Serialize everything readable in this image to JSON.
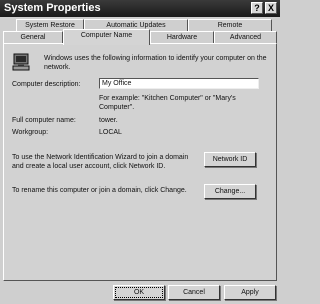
{
  "window": {
    "title": "System Properties"
  },
  "titlebar_buttons": {
    "help": "?",
    "close": "X"
  },
  "tabs_back": [
    "System Restore",
    "Automatic Updates",
    "Remote"
  ],
  "tabs_front": [
    "General",
    "Computer Name",
    "Hardware",
    "Advanced"
  ],
  "active_tab": "Computer Name",
  "computer_name": {
    "intro": "Windows uses the following information to identify your computer on the network.",
    "description_label": "Computer description:",
    "description_value": "My Office",
    "example": "For example: \"Kitchen Computer\" or \"Mary's Computer\".",
    "full_name_label": "Full computer name:",
    "full_name_value": "tower.",
    "workgroup_label": "Workgroup:",
    "workgroup_value": "LOCAL",
    "wizard_text": "To use the Network Identification Wizard to join a domain and create a local user account, click Network ID.",
    "network_id_button": "Network ID",
    "rename_text": "To rename this computer or join a domain, click Change.",
    "change_button": "Change..."
  },
  "footer": {
    "ok": "OK",
    "cancel": "Cancel",
    "apply": "Apply"
  },
  "icons": [
    "help-icon",
    "close-icon",
    "computer-icon"
  ]
}
